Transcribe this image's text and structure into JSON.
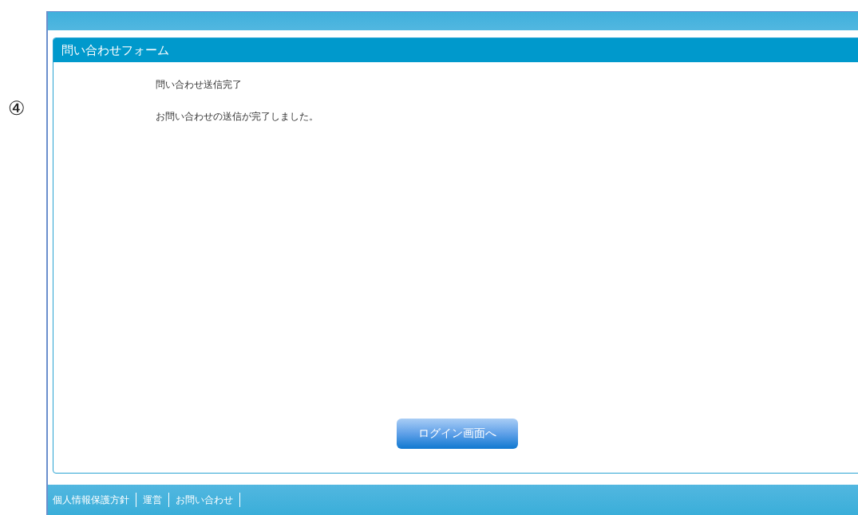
{
  "figure_label": "④",
  "panel": {
    "title": "問い合わせフォーム",
    "messages": [
      "問い合わせ送信完了",
      "お問い合わせの送信が完了しました。"
    ],
    "button": "ログイン画面へ"
  },
  "footer_links": [
    "個人情報保護方針",
    "運営",
    "お問い合わせ"
  ]
}
